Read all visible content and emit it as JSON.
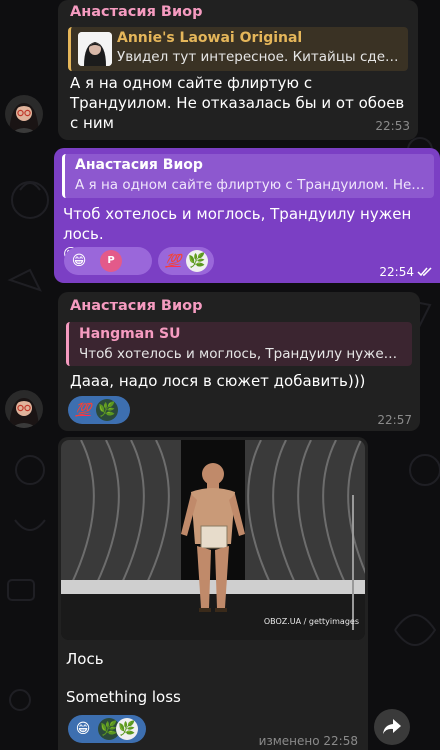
{
  "chat": {
    "messages": [
      {
        "sender": "Анастасия Виор",
        "reply_name": "Annie's Laowai Original",
        "reply_text": "Увидел тут интересное. Китайцы сделали",
        "text_lines": [
          "А я на одном сайте флиртую с",
          "Трандуилом. Не отказалась бы и от обоев",
          "с ним"
        ],
        "time": "22:53"
      },
      {
        "sender": "Анастасия Виор",
        "reply_text": "А я на одном сайте флиртую с Трандуилом. Не отказалась",
        "text": "Чтоб хотелось и моглось, Трандуилу нужен лось.",
        "emoji_line": "😁",
        "reactions": [
          "😁",
          "P",
          "💯",
          "🌿"
        ],
        "time": "22:54"
      },
      {
        "sender": "Анастасия Виор",
        "reply_name": "Hangman SU",
        "reply_text": "Чтоб хотелось и моглось, Трандуилу нужен лось.",
        "text": "Дааа, надо лося в сюжет добавить)))",
        "reactions": [
          "💯",
          "🌿"
        ],
        "time": "22:57"
      },
      {
        "photo_watermark": "OBOZ.UA / gettyimages",
        "text_lines": [
          "Лось",
          "",
          "Something loss"
        ],
        "reactions": [
          "😁",
          "🌿",
          "🌿"
        ],
        "time": "изменено 22:58"
      }
    ]
  },
  "colors": {
    "background": "#0e0e10",
    "incoming_bubble": "#212121",
    "outgoing_bubble": "#7b3fc4",
    "sender_name": "#f59bc0",
    "reply_gold": "#e5b65a",
    "outgoing_read_check": "#ffffff"
  },
  "icons": [
    "double-check-icon",
    "forward-icon"
  ]
}
